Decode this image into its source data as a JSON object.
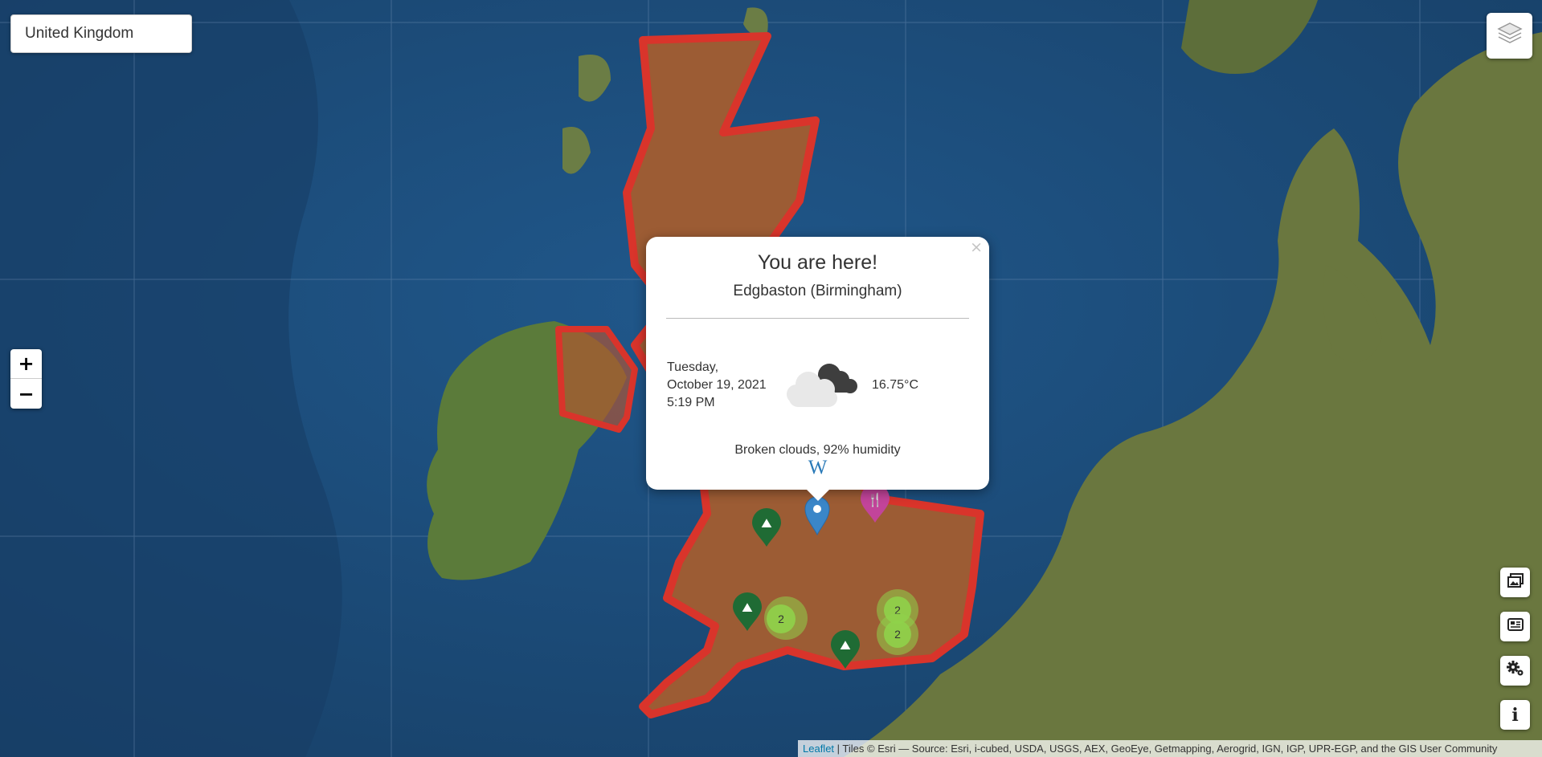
{
  "search": {
    "country": "United Kingdom"
  },
  "zoom": {
    "in_label": "+",
    "out_label": "−"
  },
  "popup": {
    "close": "×",
    "title": "You are here!",
    "subtitle": "Edgbaston (Birmingham)",
    "date_line1": "Tuesday,",
    "date_line2": "October 19, 2021",
    "date_line3": "5:19 PM",
    "weather_icon": "broken-clouds-icon",
    "temperature": "16.75°C",
    "description": "Broken clouds, 92% humidity",
    "wiki": "W"
  },
  "clusters": [
    {
      "name": "cluster-west",
      "count": "2"
    },
    {
      "name": "cluster-east-upper",
      "count": "2"
    },
    {
      "name": "cluster-east-lower",
      "count": "2"
    }
  ],
  "markers": [
    {
      "name": "hiking-marker-1",
      "icon": "hiking-icon",
      "color": "#1f6b34"
    },
    {
      "name": "hiking-marker-2",
      "icon": "hiking-icon",
      "color": "#1f6b34"
    },
    {
      "name": "hiking-marker-3",
      "icon": "hiking-icon",
      "color": "#1f6b34"
    },
    {
      "name": "restaurant-marker",
      "icon": "restaurant-icon",
      "color": "#c2449a"
    },
    {
      "name": "location-marker",
      "icon": "location-pin-icon",
      "color": "#3a86c8"
    }
  ],
  "controls": [
    {
      "name": "photos-button",
      "icon": "image-icon"
    },
    {
      "name": "news-button",
      "icon": "newspaper-icon"
    },
    {
      "name": "settings-button",
      "icon": "gears-icon"
    },
    {
      "name": "info-button",
      "icon": "info-icon"
    }
  ],
  "attribution": {
    "leaflet": "Leaflet",
    "separator": " | ",
    "text": "Tiles © Esri — Source: Esri, i-cubed, USDA, USGS, AEX, GeoEye, Getmapping, Aerogrid, IGN, IGP, UPR-EGP, and the GIS User Community"
  },
  "colors": {
    "highlight_border": "#d9342b",
    "highlight_fill": "#b5552f",
    "cluster": "#8fd24a",
    "ocean": "#1d4f7c"
  }
}
